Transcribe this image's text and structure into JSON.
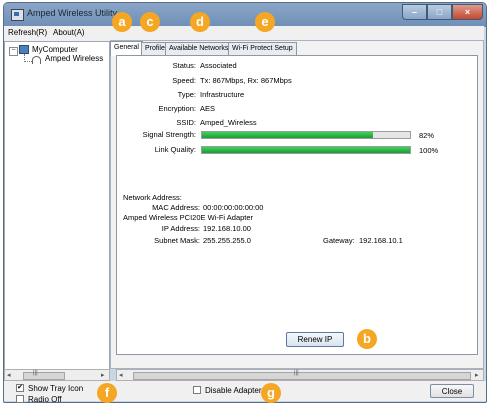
{
  "window": {
    "title": "Amped Wireless Utility",
    "minimize": "–",
    "maximize": "□",
    "close": "×"
  },
  "menu": {
    "refresh": "Refresh(R)",
    "about": "About(A)"
  },
  "tree": {
    "root": "MyComputer",
    "toggle": "−",
    "child": "Amped Wireless"
  },
  "tabs": {
    "general": "General",
    "profile": "Profile",
    "available": "Available Networks",
    "wps": "Wi-Fi Protect Setup"
  },
  "status": {
    "status_label": "Status:",
    "status_value": "Associated",
    "speed_label": "Speed:",
    "speed_value": "Tx: 867Mbps, Rx: 867Mbps",
    "type_label": "Type:",
    "type_value": "Infrastructure",
    "encryption_label": "Encryption:",
    "encryption_value": "AES",
    "ssid_label": "SSID:",
    "ssid_value": "Amped_Wireless",
    "signal_label": "Signal Strength:",
    "signal_pct": "82%",
    "signal_fraction": 0.82,
    "link_label": "Link Quality:",
    "link_pct": "100%",
    "link_fraction": 1.0
  },
  "network": {
    "heading": "Network Address:",
    "mac_label": "MAC Address:",
    "mac_value": "00:00:00:00:00:00",
    "adapter": "Amped Wireless PCI20E Wi-Fi Adapter",
    "ip_label": "IP Address:",
    "ip_value": "192.168.10.00",
    "subnet_label": "Subnet Mask:",
    "subnet_value": "255.255.255.0",
    "gateway_label": "Gateway:",
    "gateway_value": "192.168.10.1"
  },
  "buttons": {
    "renew": "Renew IP",
    "close": "Close"
  },
  "bottom": {
    "show_tray": "Show Tray Icon",
    "show_tray_checked": "✔",
    "radio_off": "Radio Off",
    "disable_adapter": "Disable Adapter"
  },
  "scroll": {
    "left_arrow": "◂",
    "right_arrow": "▸",
    "thumb_grip": "|||"
  },
  "callouts": {
    "a": "a",
    "b": "b",
    "c": "c",
    "d": "d",
    "e": "e",
    "f": "f",
    "g": "g"
  },
  "colors": {
    "callout": "#f5a623",
    "bar_fill": "#2bbd49"
  }
}
